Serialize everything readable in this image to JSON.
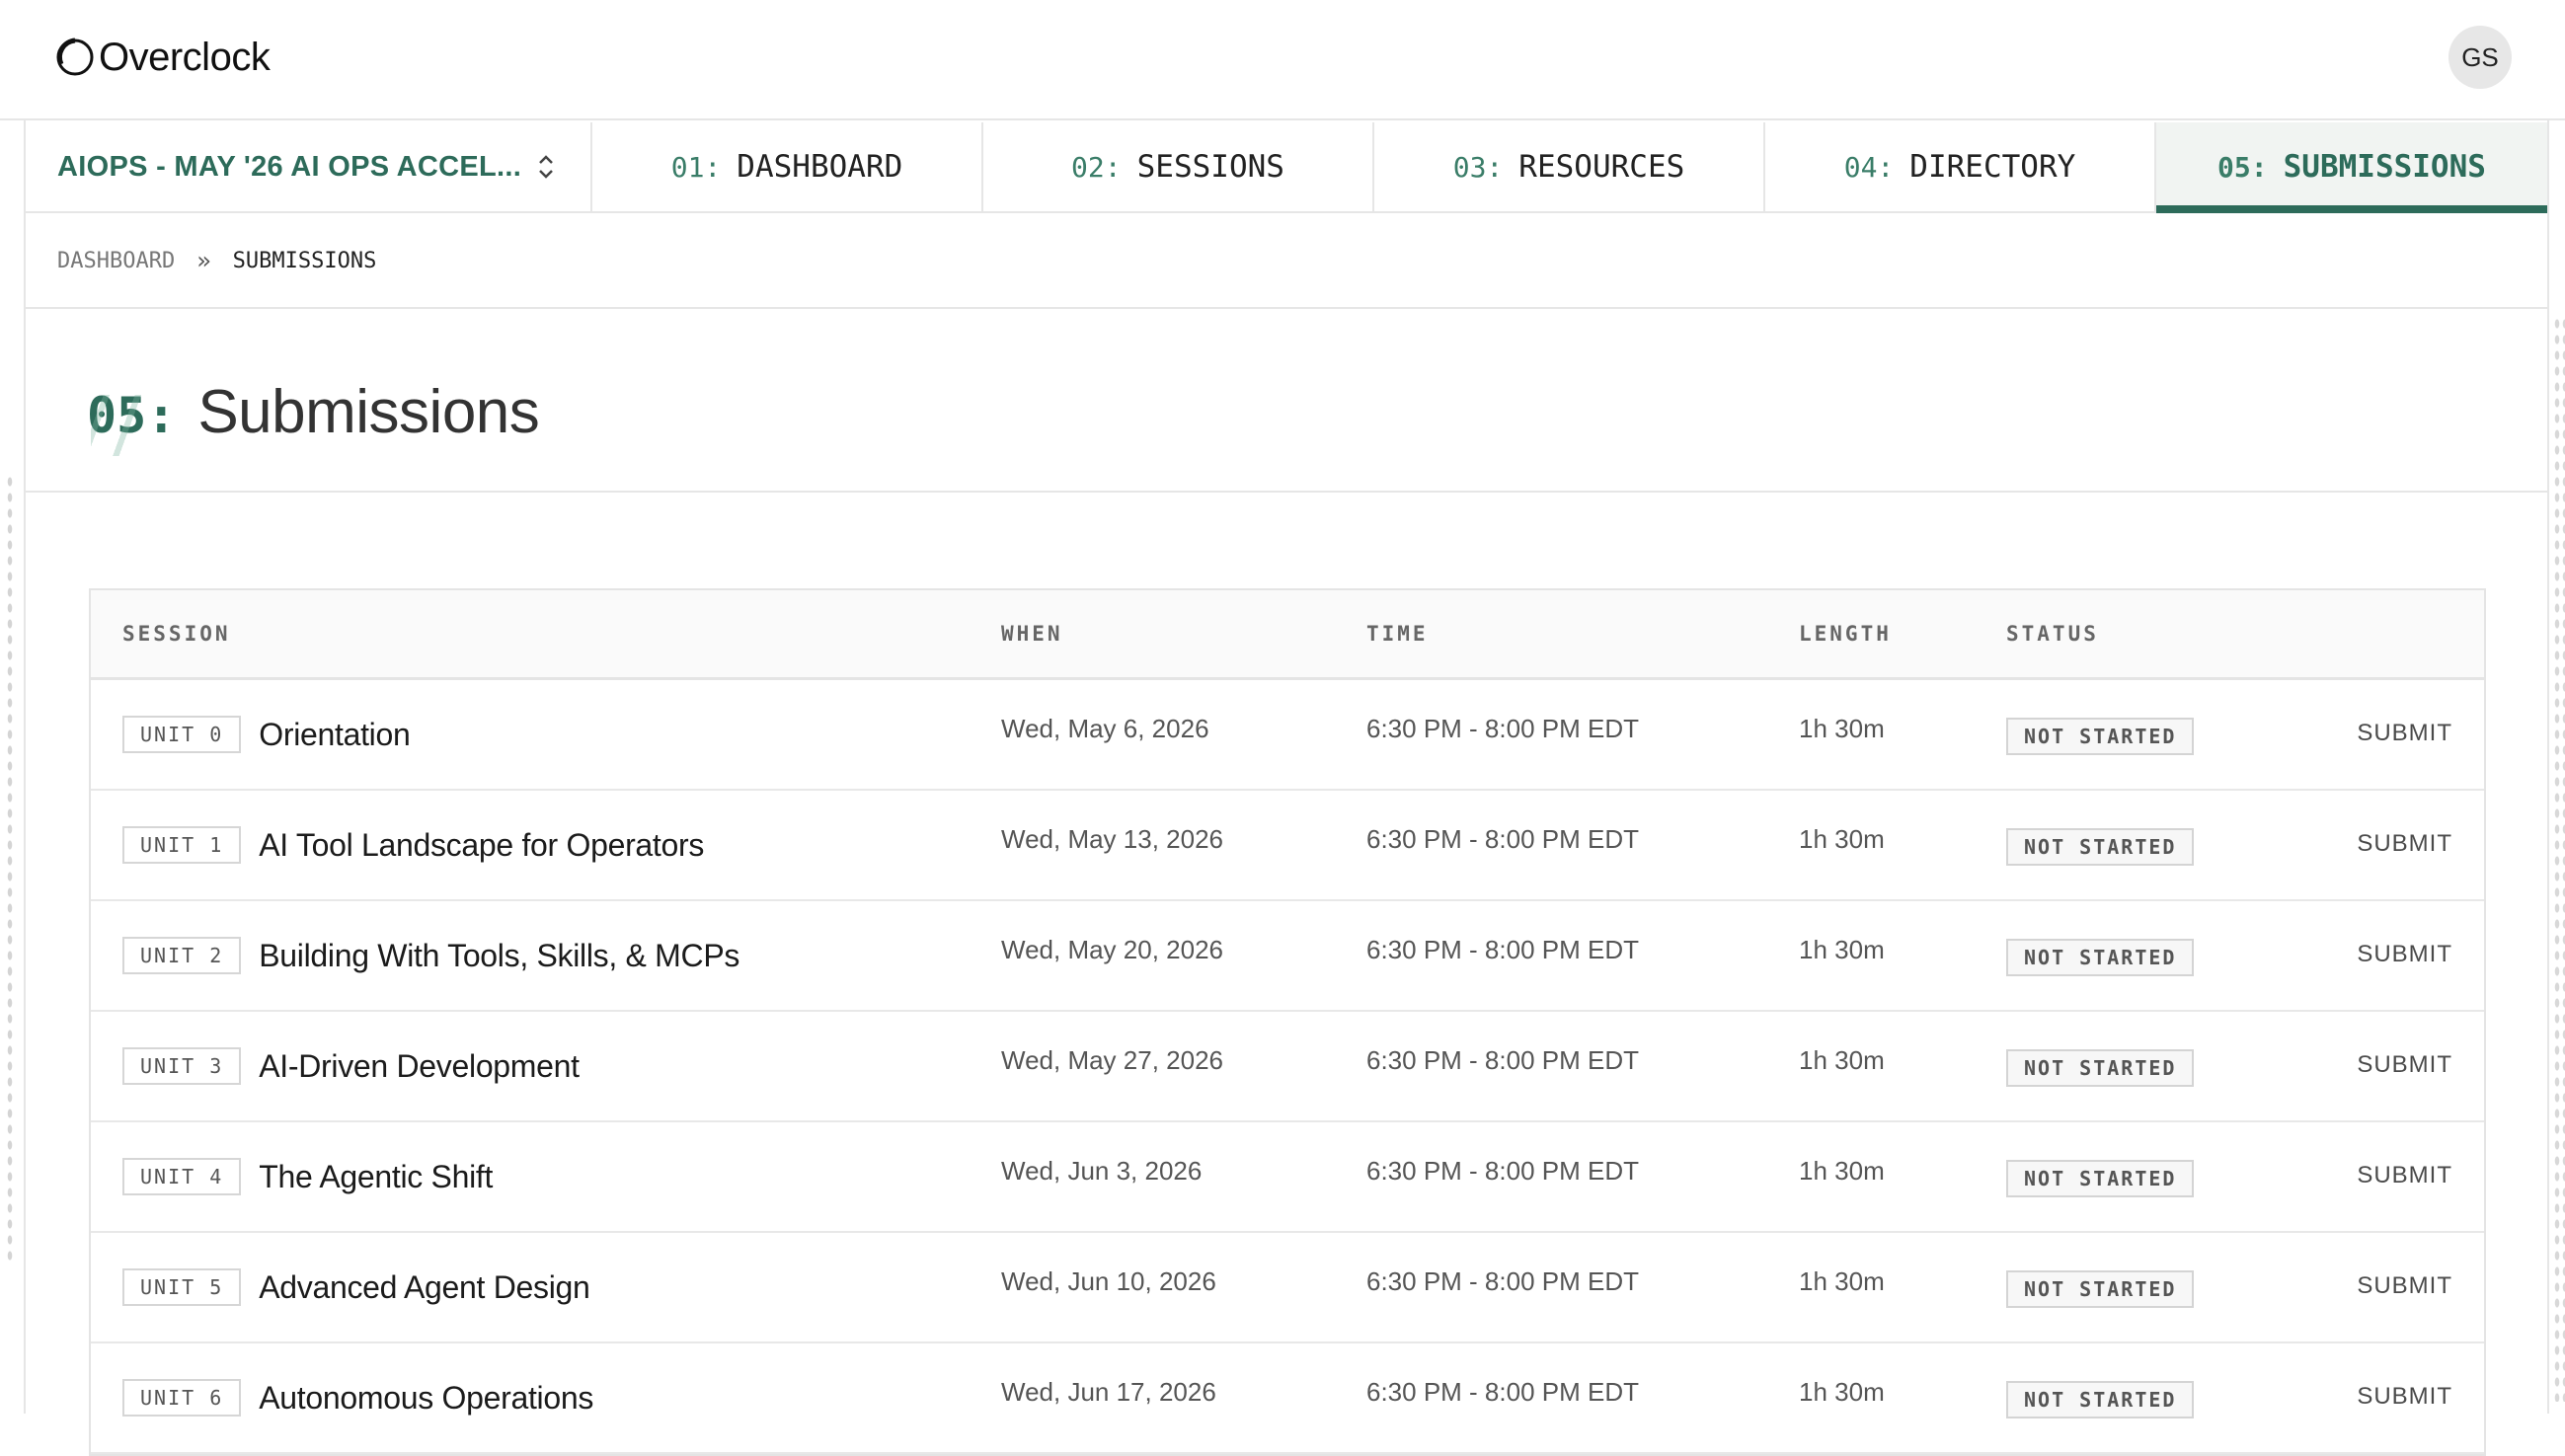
{
  "app": {
    "name": "Overclock",
    "avatar_initials": "GS"
  },
  "nav": {
    "cohort_label": "AIOPS - MAY '26 AI OPS ACCEL...",
    "tabs": [
      {
        "num": "01:",
        "label": "DASHBOARD",
        "active": false
      },
      {
        "num": "02:",
        "label": "SESSIONS",
        "active": false
      },
      {
        "num": "03:",
        "label": "RESOURCES",
        "active": false
      },
      {
        "num": "04:",
        "label": "DIRECTORY",
        "active": false
      },
      {
        "num": "05:",
        "label": "SUBMISSIONS",
        "active": true
      }
    ]
  },
  "breadcrumb": {
    "home": "DASHBOARD",
    "separator": "»",
    "current": "SUBMISSIONS"
  },
  "page": {
    "number": "05:",
    "title": "Submissions"
  },
  "table": {
    "headers": {
      "session": "SESSION",
      "when": "WHEN",
      "time": "TIME",
      "length": "LENGTH",
      "status": "STATUS"
    },
    "rows": [
      {
        "unit": "UNIT 0",
        "name": "Orientation",
        "when": "Wed, May 6, 2026",
        "time": "6:30 PM - 8:00 PM EDT",
        "length": "1h 30m",
        "status": "NOT STARTED",
        "action": "SUBMIT"
      },
      {
        "unit": "UNIT 1",
        "name": "AI Tool Landscape for Operators",
        "when": "Wed, May 13, 2026",
        "time": "6:30 PM - 8:00 PM EDT",
        "length": "1h 30m",
        "status": "NOT STARTED",
        "action": "SUBMIT"
      },
      {
        "unit": "UNIT 2",
        "name": "Building With Tools, Skills, & MCPs",
        "when": "Wed, May 20, 2026",
        "time": "6:30 PM - 8:00 PM EDT",
        "length": "1h 30m",
        "status": "NOT STARTED",
        "action": "SUBMIT"
      },
      {
        "unit": "UNIT 3",
        "name": "AI-Driven Development",
        "when": "Wed, May 27, 2026",
        "time": "6:30 PM - 8:00 PM EDT",
        "length": "1h 30m",
        "status": "NOT STARTED",
        "action": "SUBMIT"
      },
      {
        "unit": "UNIT 4",
        "name": "The Agentic Shift",
        "when": "Wed, Jun 3, 2026",
        "time": "6:30 PM - 8:00 PM EDT",
        "length": "1h 30m",
        "status": "NOT STARTED",
        "action": "SUBMIT"
      },
      {
        "unit": "UNIT 5",
        "name": "Advanced Agent Design",
        "when": "Wed, Jun 10, 2026",
        "time": "6:30 PM - 8:00 PM EDT",
        "length": "1h 30m",
        "status": "NOT STARTED",
        "action": "SUBMIT"
      },
      {
        "unit": "UNIT 6",
        "name": "Autonomous Operations",
        "when": "Wed, Jun 17, 2026",
        "time": "6:30 PM - 8:00 PM EDT",
        "length": "1h 30m",
        "status": "NOT STARTED",
        "action": "SUBMIT"
      }
    ]
  },
  "colors": {
    "accent": "#2d6b5a",
    "border": "#e6e6e6"
  },
  "icons": {
    "logo": "overclock-logo-icon",
    "cohort_switch": "chevron-updown-icon",
    "breadcrumb_sep": "double-chevron-right-icon"
  }
}
